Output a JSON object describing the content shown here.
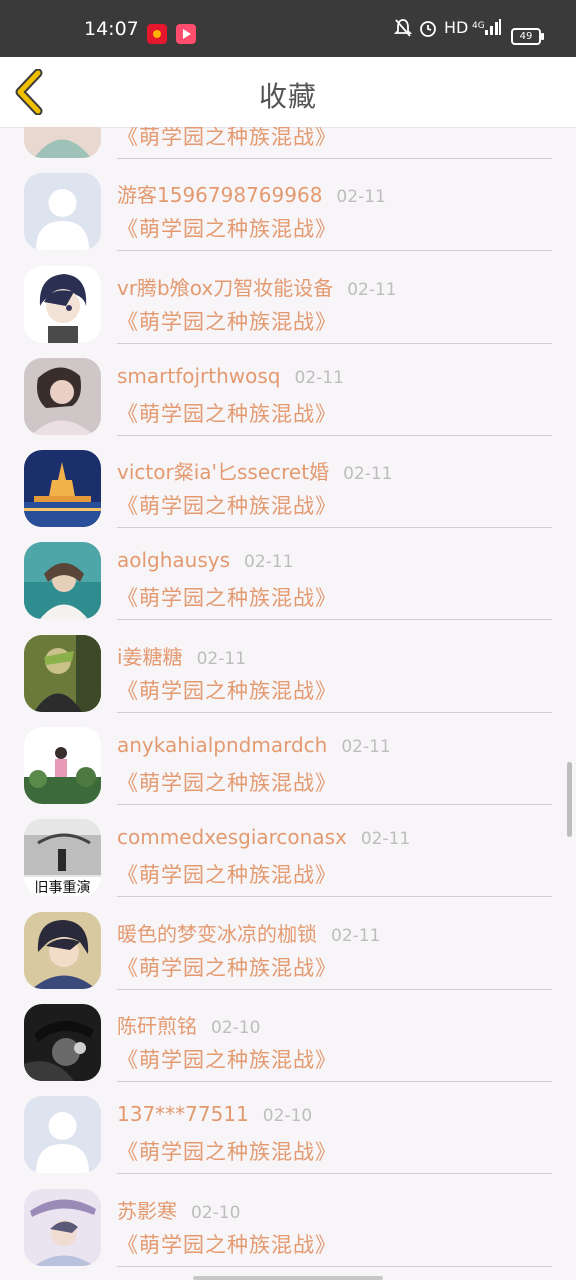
{
  "status_bar": {
    "time": "14:07",
    "network": "HD",
    "signal": "4G",
    "battery": "49",
    "icons": [
      "weibo-icon",
      "video-app-icon",
      "mute-bell-icon",
      "alarm-icon",
      "signal-icon",
      "battery-icon"
    ]
  },
  "header": {
    "title": "收藏",
    "back_icon": "chevron-left-icon"
  },
  "colors": {
    "accent": "#e39a70",
    "back_arrow": "#f0c000",
    "date": "#bdbdbd",
    "background": "#f8f5f8"
  },
  "items": [
    {
      "name": "",
      "date": "",
      "title": "《萌学园之种族混战》",
      "avatar": "photo"
    },
    {
      "name": "游客1596798769968",
      "date": "02-11",
      "title": "《萌学园之种族混战》",
      "avatar": "default"
    },
    {
      "name": "vr腾b飧ox刀智妆能设备",
      "date": "02-11",
      "title": "《萌学园之种族混战》",
      "avatar": "anime"
    },
    {
      "name": "smartfojrthwosq",
      "date": "02-11",
      "title": "《萌学园之种族混战》",
      "avatar": "photo"
    },
    {
      "name": "victor粲ia'匕ssecret婚",
      "date": "02-11",
      "title": "《萌学园之种族混战》",
      "avatar": "temple"
    },
    {
      "name": "aolghausys",
      "date": "02-11",
      "title": "《萌学园之种族混战》",
      "avatar": "sea"
    },
    {
      "name": "i姜糖糖",
      "date": "02-11",
      "title": "《萌学园之种族混战》",
      "avatar": "photo"
    },
    {
      "name": "anykahialpndmardch",
      "date": "02-11",
      "title": "《萌学园之种族混战》",
      "avatar": "garden"
    },
    {
      "name": "commedxesgiarconasx",
      "date": "02-11",
      "title": "《萌学园之种族混战》",
      "avatar": "street"
    },
    {
      "name": "暖色的梦变冰凉的枷锁",
      "date": "02-11",
      "title": "《萌学园之种族混战》",
      "avatar": "anime"
    },
    {
      "name": "陈矸煎铭",
      "date": "02-10",
      "title": "《萌学园之种族混战》",
      "avatar": "dark"
    },
    {
      "name": "137***77511",
      "date": "02-10",
      "title": "《萌学园之种族混战》",
      "avatar": "default"
    },
    {
      "name": "苏影寒",
      "date": "02-10",
      "title": "《萌学园之种族混战》",
      "avatar": "umbrella"
    }
  ],
  "avatar_overlay_text": "旧事重演"
}
